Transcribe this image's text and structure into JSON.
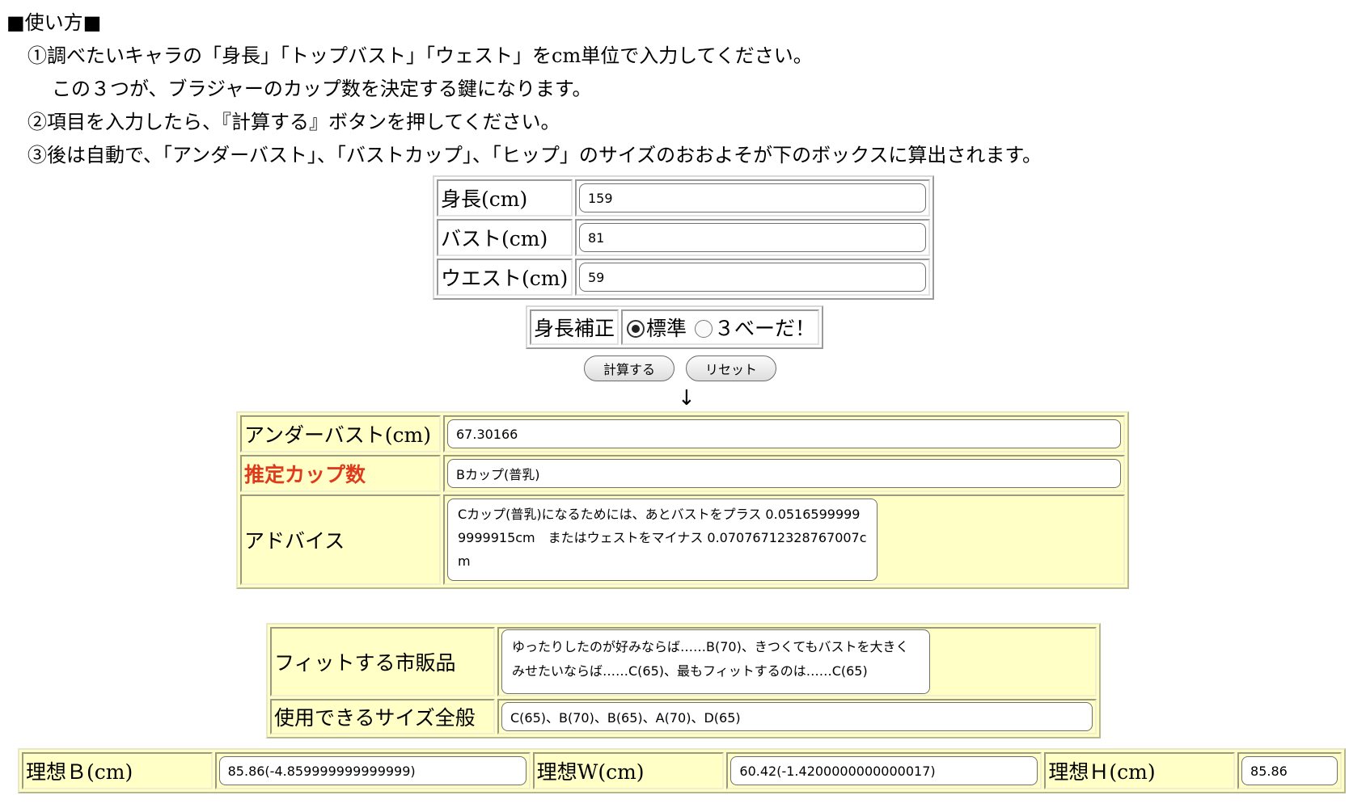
{
  "instructions": {
    "title": "■使い方■",
    "step1": "①調べたいキャラの「身長」「トップバスト」「ウェスト」をcm単位で入力してください。",
    "step1b": "この３つが、ブラジャーのカップ数を決定する鍵になります。",
    "step2": "②項目を入力したら、『計算する』ボタンを押してください。",
    "step3": "③後は自動で、「アンダーバスト」、「バストカップ」、「ヒップ」のサイズのおおよそが下のボックスに算出されます。"
  },
  "inputs": {
    "height_label": "身長(cm)",
    "height_value": "159",
    "bust_label": "バスト(cm)",
    "bust_value": "81",
    "waist_label": "ウエスト(cm)",
    "waist_value": "59"
  },
  "correction": {
    "label": "身長補正",
    "option_standard": "標準",
    "option_other": "３べーだ！",
    "selected": "標準"
  },
  "buttons": {
    "calculate": "計算する",
    "reset": "リセット"
  },
  "arrow": "↓",
  "results": {
    "underbust_label": "アンダーバスト(cm)",
    "underbust_value": "67.30166",
    "cup_label": "推定カップ数",
    "cup_value": "Bカップ(普乳)",
    "advice_label": "アドバイス",
    "advice_value": "Cカップ(普乳)になるためには、あとバストをプラス 0.05165999999999915cm　またはウェストをマイナス 0.07076712328767007cm"
  },
  "products": {
    "fit_label": "フィットする市販品",
    "fit_value": "ゆったりしたのが好みならば……B(70)、きつくてもバストを大きくみせたいならば……C(65)、最もフィットするのは……C(65)",
    "sizes_label": "使用できるサイズ全般",
    "sizes_value": "C(65)、B(70)、B(65)、A(70)、D(65)"
  },
  "ideal": {
    "b_label": "理想Ｂ(cm)",
    "b_value": "85.86(-4.859999999999999)",
    "w_label": "理想W(cm)",
    "w_value": "60.42(-1.4200000000000017)",
    "h_label": "理想Ｈ(cm)",
    "h_value": "85.86"
  },
  "colors": {
    "panel_yellow": "#ffffc6",
    "accent_red": "#e03a1e"
  }
}
